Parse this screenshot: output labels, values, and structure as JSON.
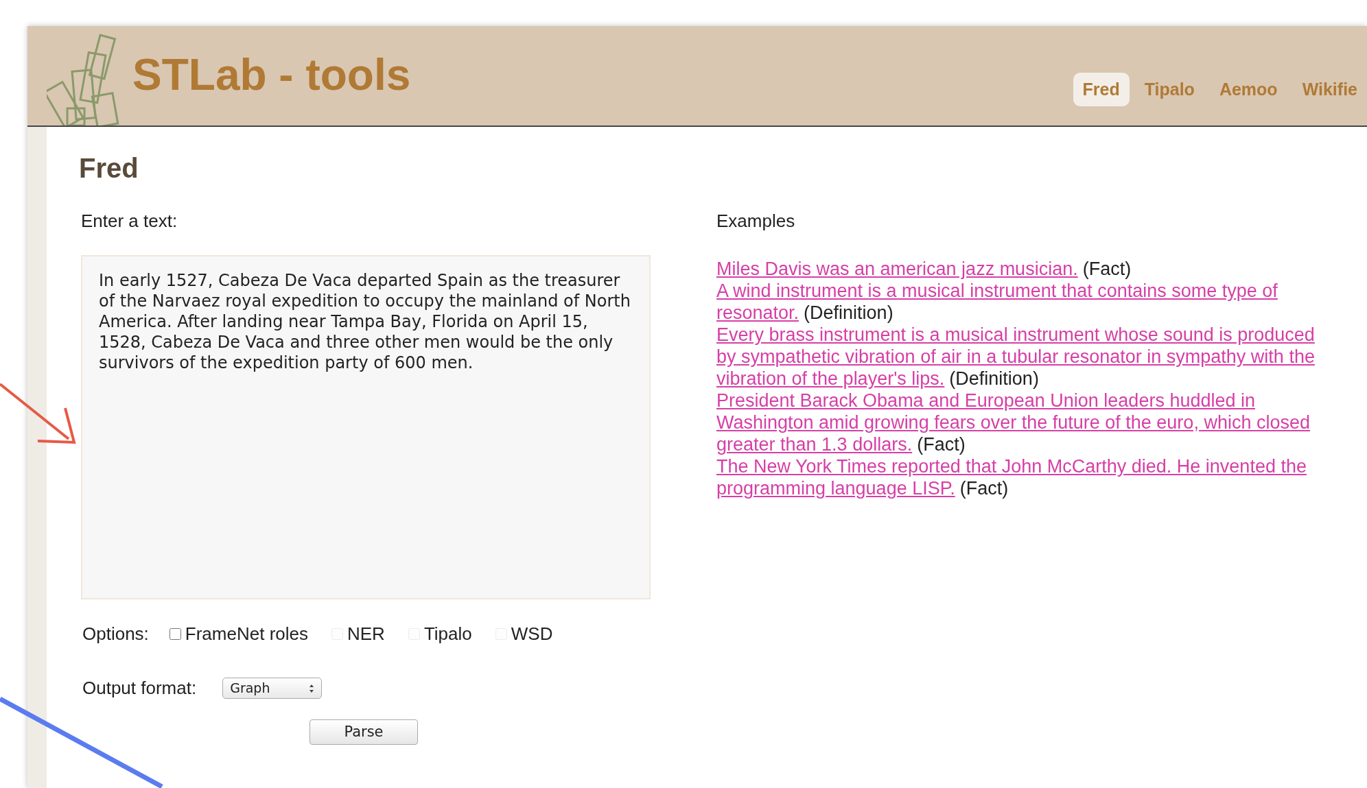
{
  "header": {
    "title": "STLab - tools",
    "nav": [
      {
        "label": "Fred",
        "selected": true
      },
      {
        "label": "Tipalo",
        "selected": false
      },
      {
        "label": "Aemoo",
        "selected": false
      },
      {
        "label": "Wikifie",
        "selected": false
      }
    ]
  },
  "page": {
    "heading": "Fred",
    "input_label": "Enter a text:",
    "input_text": "In early 1527, Cabeza De Vaca departed Spain as the treasurer of the Narvaez royal expedition to occupy the mainland of North America. After landing near Tampa Bay, Florida on April 15, 1528, Cabeza De Vaca and three other men would be the only survivors of the expedition party of 600 men.",
    "options_label": "Options:",
    "options": [
      {
        "label": "FrameNet roles",
        "checked": false,
        "disabled": false
      },
      {
        "label": "NER",
        "checked": false,
        "disabled": true
      },
      {
        "label": "Tipalo",
        "checked": false,
        "disabled": true
      },
      {
        "label": "WSD",
        "checked": false,
        "disabled": true
      }
    ],
    "output_label": "Output format:",
    "output_value": "Graph",
    "parse_button": "Parse"
  },
  "examples": {
    "title": "Examples",
    "items": [
      {
        "lines": [
          "Miles Davis was an american jazz musician."
        ],
        "type": "(Fact)"
      },
      {
        "lines": [
          "A wind instrument is a musical instrument that contains some type of",
          "resonator."
        ],
        "type": "(Definition)"
      },
      {
        "lines": [
          "Every brass instrument is a musical instrument whose sound is produced",
          "by sympathetic vibration of air in a tubular resonator in sympathy with the",
          "vibration of the player's lips."
        ],
        "type": "(Definition)"
      },
      {
        "lines": [
          "President Barack Obama and European Union leaders huddled in",
          "Washington amid growing fears over the future of the euro, which closed",
          "greater than 1.3 dollars."
        ],
        "type": "(Fact)"
      },
      {
        "lines": [
          "The New York Times reported that John McCarthy died. He invented the",
          "programming language LISP."
        ],
        "type": "(Fact)"
      }
    ]
  }
}
